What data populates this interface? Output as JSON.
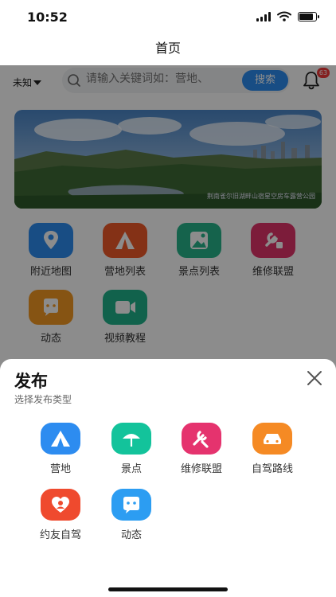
{
  "status_bar": {
    "time": "10:52"
  },
  "nav": {
    "title": "首页"
  },
  "search": {
    "location": "未知",
    "placeholder": "请输入关键词如：营地、",
    "button_label": "搜索",
    "notification_count": "63"
  },
  "banner": {
    "caption": "荆南雀尔旧湖畔山宿星空房车露营公园"
  },
  "menu": {
    "items": [
      {
        "label": "附近地图",
        "icon": "map-pin-icon",
        "color": "#2d8cf0"
      },
      {
        "label": "营地列表",
        "icon": "tent-icon",
        "color": "#f05a28"
      },
      {
        "label": "景点列表",
        "icon": "landscape-icon",
        "color": "#27b58a"
      },
      {
        "label": "维修联盟",
        "icon": "wrench-icon",
        "color": "#e2336b"
      },
      {
        "label": "动态",
        "icon": "chat-bubble-icon",
        "color": "#f59a23"
      },
      {
        "label": "视频教程",
        "icon": "video-camera-icon",
        "color": "#1fb28a"
      }
    ]
  },
  "sheet": {
    "title": "发布",
    "subtitle": "选择发布类型",
    "items": [
      {
        "label": "营地",
        "icon": "tent-icon",
        "color": "#2d8cf0"
      },
      {
        "label": "景点",
        "icon": "umbrella-icon",
        "color": "#13c39b"
      },
      {
        "label": "维修联盟",
        "icon": "wrench-icon",
        "color": "#e5336e"
      },
      {
        "label": "自驾路线",
        "icon": "car-icon",
        "color": "#f58a24"
      },
      {
        "label": "约友自驾",
        "icon": "heart-user-icon",
        "color": "#ef4a2e"
      },
      {
        "label": "动态",
        "icon": "chat-bubble-icon",
        "color": "#2c9df2"
      }
    ]
  }
}
